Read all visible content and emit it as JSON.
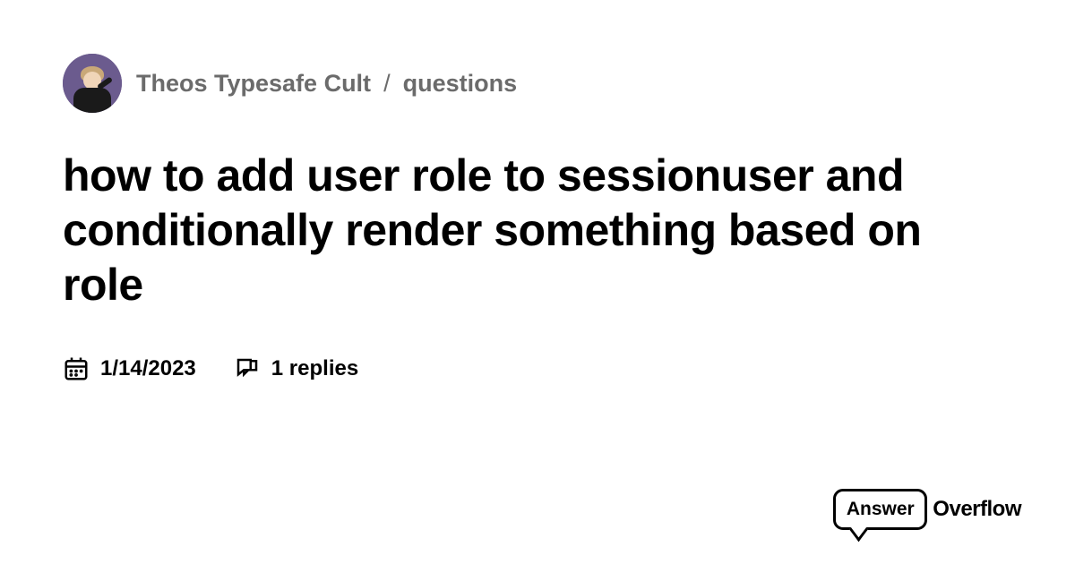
{
  "breadcrumb": {
    "community": "Theos Typesafe Cult",
    "section": "questions"
  },
  "title": "how to add user role to sessionuser and conditionally render something based on role",
  "meta": {
    "date": "1/14/2023",
    "replies": "1 replies"
  },
  "logo": {
    "answer": "Answer",
    "overflow": "Overflow"
  }
}
